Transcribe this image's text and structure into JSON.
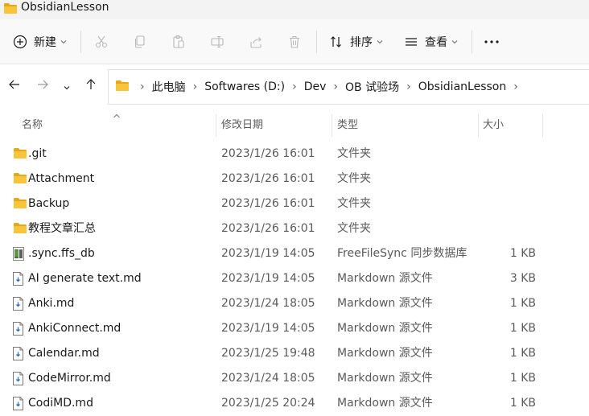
{
  "window": {
    "title": "ObsidianLesson"
  },
  "toolbar": {
    "new_label": "新建",
    "sort_label": "排序",
    "view_label": "查看"
  },
  "breadcrumb": [
    "此电脑",
    "Softwares (D:)",
    "Dev",
    "OB 试验场",
    "ObsidianLesson"
  ],
  "columns": {
    "name": "名称",
    "date": "修改日期",
    "type": "类型",
    "size": "大小"
  },
  "files": [
    {
      "name": ".git",
      "date": "2023/1/26 16:01",
      "type": "文件夹",
      "size": "",
      "icon": "folder-icon"
    },
    {
      "name": "Attachment",
      "date": "2023/1/26 16:01",
      "type": "文件夹",
      "size": "",
      "icon": "folder-icon"
    },
    {
      "name": "Backup",
      "date": "2023/1/26 16:01",
      "type": "文件夹",
      "size": "",
      "icon": "folder-icon"
    },
    {
      "name": "教程文章汇总",
      "date": "2023/1/26 16:01",
      "type": "文件夹",
      "size": "",
      "icon": "folder-icon"
    },
    {
      "name": ".sync.ffs_db",
      "date": "2023/1/19 14:05",
      "type": "FreeFileSync 同步数据库",
      "size": "1 KB",
      "icon": "database-file-icon"
    },
    {
      "name": "AI generate text.md",
      "date": "2023/1/19 14:05",
      "type": "Markdown 源文件",
      "size": "3 KB",
      "icon": "markdown-file-icon"
    },
    {
      "name": "Anki.md",
      "date": "2023/1/24 18:05",
      "type": "Markdown 源文件",
      "size": "1 KB",
      "icon": "markdown-file-icon"
    },
    {
      "name": "AnkiConnect.md",
      "date": "2023/1/19 14:05",
      "type": "Markdown 源文件",
      "size": "1 KB",
      "icon": "markdown-file-icon"
    },
    {
      "name": "Calendar.md",
      "date": "2023/1/25 19:48",
      "type": "Markdown 源文件",
      "size": "1 KB",
      "icon": "markdown-file-icon"
    },
    {
      "name": "CodeMirror.md",
      "date": "2023/1/24 18:05",
      "type": "Markdown 源文件",
      "size": "1 KB",
      "icon": "markdown-file-icon"
    },
    {
      "name": "CodiMD.md",
      "date": "2023/1/25 20:24",
      "type": "Markdown 源文件",
      "size": "1 KB",
      "icon": "markdown-file-icon"
    }
  ],
  "colors": {
    "folder": "#f8c53a",
    "folder_dark": "#e6a817",
    "accent": "#005fb8"
  }
}
